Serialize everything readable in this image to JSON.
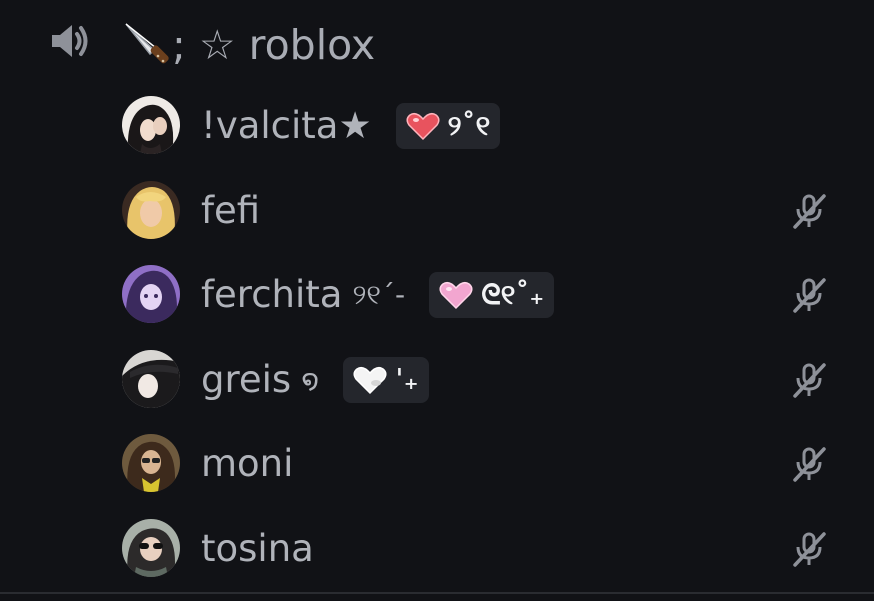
{
  "channel": {
    "name": "; ☆ roblox",
    "speaker_icon": "speaker-icon",
    "emoji_icon": "knife-icon"
  },
  "colors": {
    "background": "#111216",
    "text": "#b0b3ba",
    "badge_bg": "#24262c",
    "mute_icon": "#8e9199"
  },
  "members": [
    {
      "name": "!valcita★",
      "suffix": "",
      "badge": "୨˚୧",
      "heart_color": "#e8535e",
      "muted": false
    },
    {
      "name": "fefi",
      "suffix": "",
      "badge": null,
      "heart_color": null,
      "muted": true
    },
    {
      "name": "ferchita",
      "suffix": "୨୧´-",
      "badge": "ᘓ୧˚₊",
      "heart_color": "#f2a6d0",
      "muted": true
    },
    {
      "name": "greis",
      "suffix": "໑",
      "badge": "ˈ₊",
      "heart_color": "#f4f4f4",
      "muted": true
    },
    {
      "name": "moni",
      "suffix": "",
      "badge": null,
      "heart_color": null,
      "muted": true
    },
    {
      "name": "tosina",
      "suffix": "",
      "badge": null,
      "heart_color": null,
      "muted": true
    }
  ]
}
